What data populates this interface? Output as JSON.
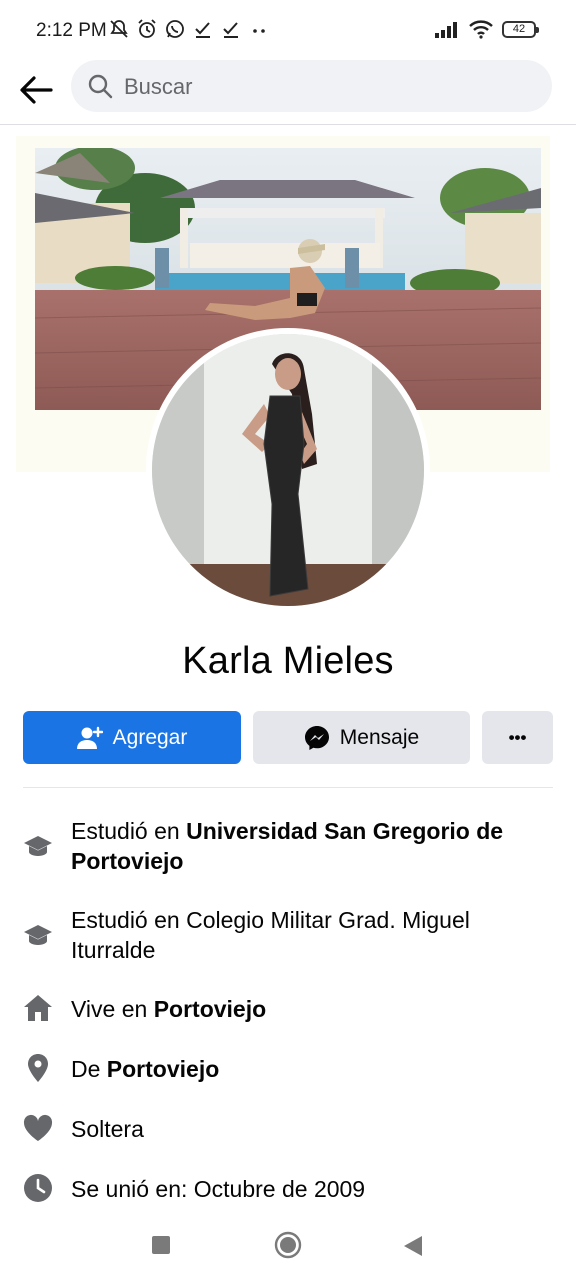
{
  "status_bar": {
    "time": "2:12 PM",
    "battery": "42",
    "icons": [
      "mute-icon",
      "alarm-icon",
      "whatsapp-icon",
      "check-icon",
      "check-icon",
      "more-dots-icon",
      "signal-icon",
      "wifi-icon",
      "battery-icon"
    ]
  },
  "search": {
    "placeholder": "Buscar"
  },
  "profile": {
    "name": "Karla Mieles"
  },
  "actions": {
    "add_label": "Agregar",
    "message_label": "Mensaje",
    "more_label": "•••"
  },
  "intro": [
    {
      "icon": "graduation-cap-icon",
      "prefix": "Estudió en ",
      "bold": "Universidad San Gregorio de Portoviejo",
      "suffix": ""
    },
    {
      "icon": "graduation-cap-icon",
      "prefix": "Estudió en Colegio Militar Grad. Miguel Iturralde",
      "bold": "",
      "suffix": ""
    },
    {
      "icon": "home-icon",
      "prefix": "Vive en ",
      "bold": "Portoviejo",
      "suffix": ""
    },
    {
      "icon": "location-pin-icon",
      "prefix": "De ",
      "bold": "Portoviejo",
      "suffix": ""
    },
    {
      "icon": "heart-icon",
      "prefix": "Soltera",
      "bold": "",
      "suffix": ""
    },
    {
      "icon": "clock-icon",
      "prefix": "Se unió en: Octubre de 2009",
      "bold": "",
      "suffix": ""
    }
  ],
  "colors": {
    "accent": "#1b74e4",
    "button_gray": "#e4e6eb",
    "icon_gray": "#65676b"
  }
}
